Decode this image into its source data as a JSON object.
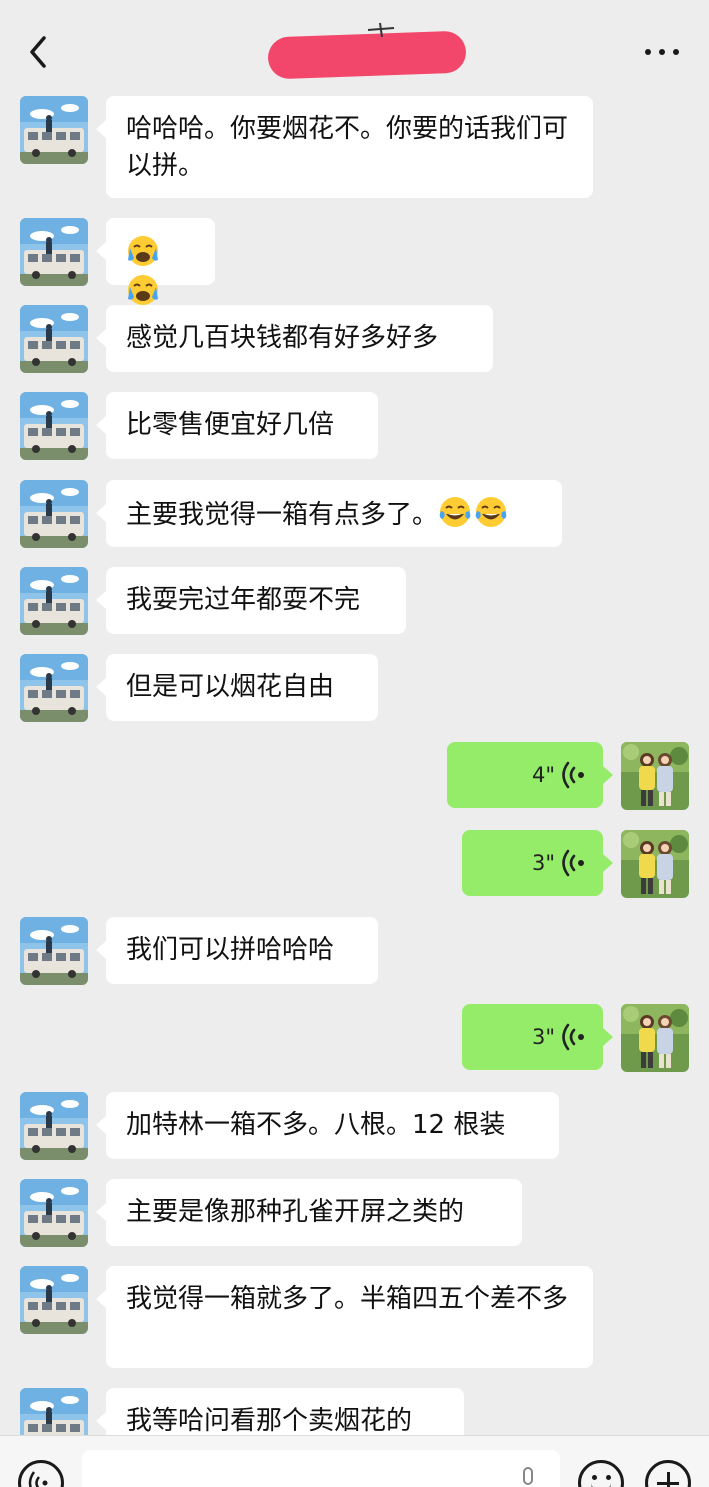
{
  "header": {
    "back_icon": "chevron-left-icon",
    "title_redaction_text": "",
    "more_icon": "more-dots-icon"
  },
  "avatars": {
    "contact": "tram-scene-avatar",
    "me": "couple-illustration-avatar"
  },
  "messages": [
    {
      "from": "contact",
      "type": "text",
      "text": "哈哈哈。你要烟花不。你要的话我们可以拼。"
    },
    {
      "from": "contact",
      "type": "emoji",
      "emojis": [
        "loudly-crying-face",
        "loudly-crying-face"
      ]
    },
    {
      "from": "contact",
      "type": "text",
      "text": "感觉几百块钱都有好多好多"
    },
    {
      "from": "contact",
      "type": "text",
      "text": "比零售便宜好几倍"
    },
    {
      "from": "contact",
      "type": "text",
      "text": "主要我觉得一箱有点多了。",
      "emojis": [
        "tears-of-joy-face",
        "tears-of-joy-face"
      ]
    },
    {
      "from": "contact",
      "type": "text",
      "text": "我耍完过年都耍不完"
    },
    {
      "from": "contact",
      "type": "text",
      "text": "但是可以烟花自由"
    },
    {
      "from": "me",
      "type": "voice",
      "duration": "4\""
    },
    {
      "from": "me",
      "type": "voice",
      "duration": "3\""
    },
    {
      "from": "contact",
      "type": "text",
      "text": "我们可以拼哈哈哈"
    },
    {
      "from": "me",
      "type": "voice",
      "duration": "3\""
    },
    {
      "from": "contact",
      "type": "text",
      "text": "加特林一箱不多。八根。12 根装"
    },
    {
      "from": "contact",
      "type": "text",
      "text": "主要是像那种孔雀开屏之类的"
    },
    {
      "from": "contact",
      "type": "text",
      "text": "我觉得一箱就多了。半箱四五个差不多"
    },
    {
      "from": "contact",
      "type": "text",
      "text": "我等哈问看那个卖烟花的"
    }
  ],
  "input_bar": {
    "voice_icon": "voice-mode-icon",
    "input_value": "",
    "mic_icon": "microphone-icon",
    "emoji_icon": "smiley-icon",
    "plus_icon": "plus-icon"
  },
  "colors": {
    "background": "#ededed",
    "incoming_bubble": "#ffffff",
    "outgoing_bubble": "#95ec69",
    "title_redaction": "#f2466a"
  }
}
